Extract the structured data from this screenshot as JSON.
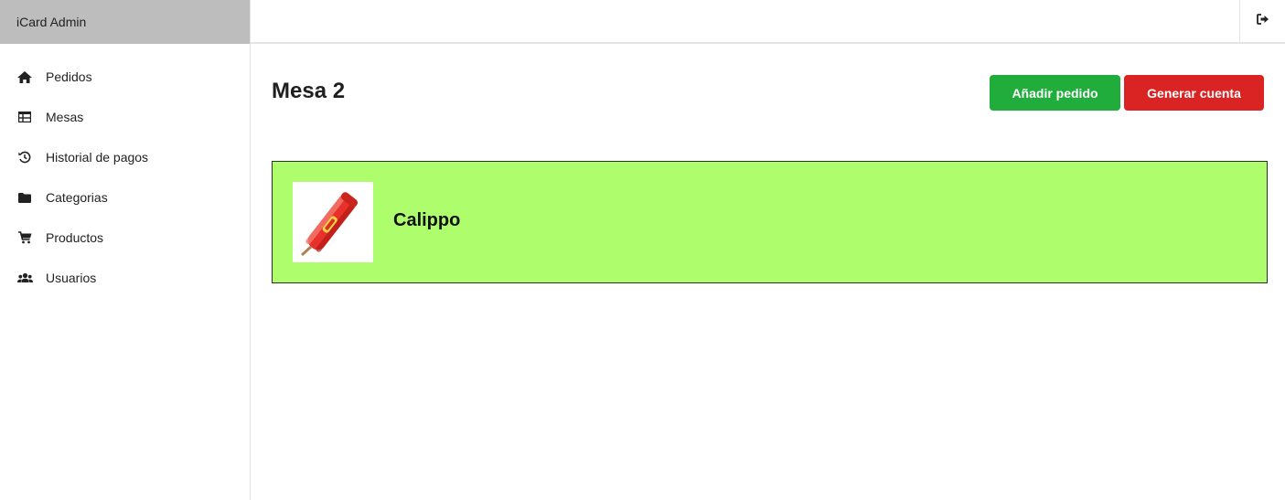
{
  "app": {
    "brand": "iCard Admin"
  },
  "header": {
    "logout_icon": "sign-out-icon"
  },
  "sidebar": {
    "items": [
      {
        "label": "Pedidos",
        "icon": "home-icon"
      },
      {
        "label": "Mesas",
        "icon": "table-icon"
      },
      {
        "label": "Historial de pagos",
        "icon": "history-icon"
      },
      {
        "label": "Categorias",
        "icon": "folder-icon"
      },
      {
        "label": "Productos",
        "icon": "cart-icon"
      },
      {
        "label": "Usuarios",
        "icon": "users-icon"
      }
    ]
  },
  "main": {
    "title": "Mesa 2",
    "add_order_label": "Añadir pedido",
    "generate_bill_label": "Generar cuenta",
    "orders": [
      {
        "product": "Calippo",
        "image_icon": "calippo-popsicle-image",
        "card_color": "#aefd6c"
      }
    ]
  },
  "colors": {
    "brand_bg": "#bdbdbd",
    "add_button": "#21ad3b",
    "bill_button": "#da2424",
    "order_card": "#aefd6c"
  }
}
